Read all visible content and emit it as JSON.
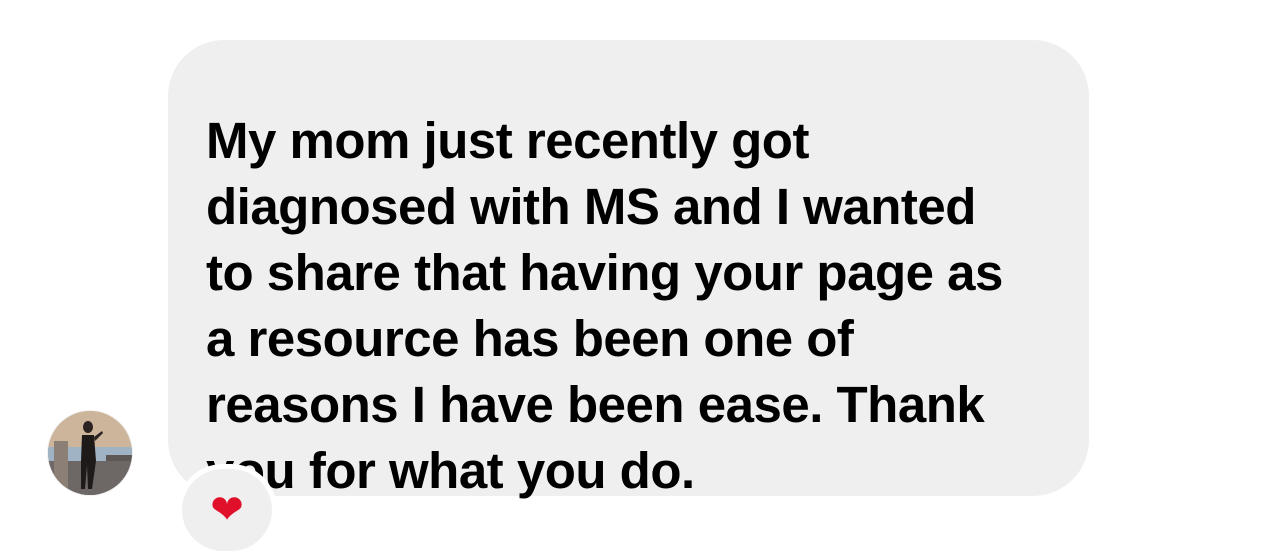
{
  "conversation": {
    "message": {
      "text": "My mom just recently got\ndiagnosed with MS and I wanted\nto share that having your page as\na resource has been one of\nreasons I have been ease. Thank\nyou for what you do."
    },
    "reaction": {
      "emoji": "❤",
      "icon": "red-heart-icon"
    },
    "avatar": {
      "icon": "profile-photo"
    }
  },
  "colors": {
    "bubble": "#efefef",
    "text": "#000000",
    "heart": "#e0102b",
    "background": "#ffffff"
  }
}
